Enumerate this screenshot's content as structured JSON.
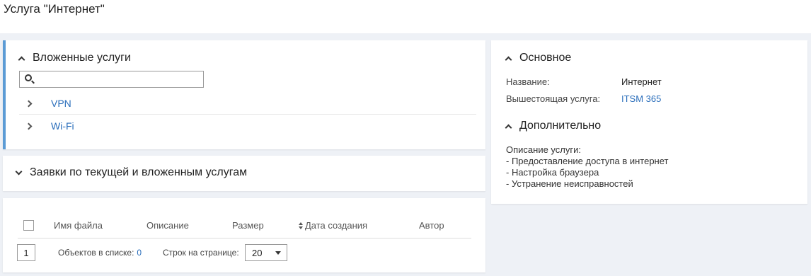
{
  "page": {
    "title": "Услуга \"Интернет\""
  },
  "nested_services": {
    "title": "Вложенные услуги",
    "search_placeholder": "",
    "items": [
      {
        "label": "VPN"
      },
      {
        "label": "Wi-Fi"
      }
    ]
  },
  "requests": {
    "title": "Заявки по текущей и вложенным услугам"
  },
  "files": {
    "columns": [
      "Имя файла",
      "Описание",
      "Размер",
      "Дата создания",
      "Автор"
    ],
    "current_page": "1",
    "objects_label": "Объектов в списке:",
    "objects_count": "0",
    "per_page_label": "Строк на странице:",
    "per_page_value": "20"
  },
  "main": {
    "title": "Основное",
    "name_label": "Название:",
    "name_value": "Интернет",
    "parent_label": "Вышестоящая услуга:",
    "parent_value": "ITSM 365"
  },
  "extra": {
    "title": "Дополнительно",
    "desc_label": "Описание услуги:",
    "desc_lines": [
      "- Предоставление доступа в интернет",
      "- Настройка браузера",
      "- Устранение неисправностей"
    ]
  },
  "colors": {
    "accent": "#5b9bd5",
    "link": "#2a6ebb",
    "background": "#eef1f6"
  }
}
